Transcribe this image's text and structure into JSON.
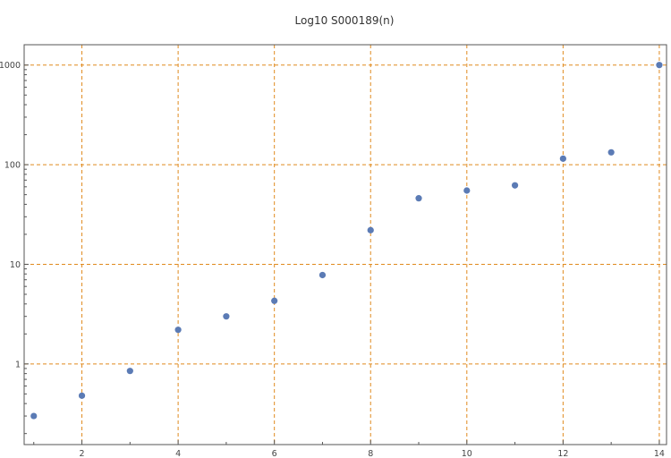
{
  "chart_data": {
    "type": "scatter",
    "title": "Log10 S000189(n)",
    "xlabel": "",
    "ylabel": "",
    "y_scale": "log",
    "xlim": [
      0.8,
      14.15
    ],
    "ylim": [
      0.155,
      1600
    ],
    "x_ticks": [
      2,
      4,
      6,
      8,
      10,
      12,
      14
    ],
    "y_ticks": [
      1,
      10,
      100,
      1000
    ],
    "x_tick_labels": [
      "2",
      "4",
      "6",
      "8",
      "10",
      "12",
      "14"
    ],
    "y_tick_labels": [
      "1",
      "10",
      "100",
      "1000"
    ],
    "grid": true,
    "colors": {
      "points": "#5b7bb5",
      "grid": "#e08a1e",
      "frame": "#555555"
    },
    "series": [
      {
        "x": [
          1,
          2,
          3,
          4,
          5,
          6,
          7,
          8,
          9,
          10,
          11,
          12,
          13,
          14
        ],
        "y": [
          0.3,
          0.48,
          0.85,
          2.2,
          3.0,
          4.3,
          7.8,
          22,
          46,
          55,
          62,
          115,
          133,
          1000
        ]
      }
    ]
  }
}
